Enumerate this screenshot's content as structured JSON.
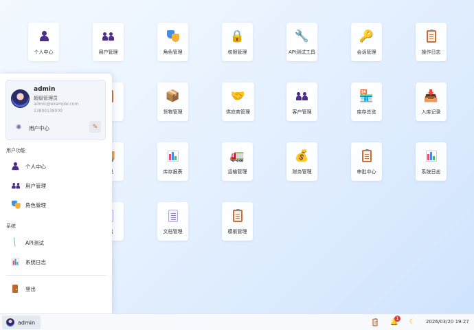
{
  "desktop": {
    "apps": [
      {
        "label": "个人中心",
        "icon": "person-icon"
      },
      {
        "label": "用户管理",
        "icon": "users-icon"
      },
      {
        "label": "角色管理",
        "icon": "masks-icon"
      },
      {
        "label": "权限管理",
        "icon": "lock-icon"
      },
      {
        "label": "API测试工具",
        "icon": "wrench-icon"
      },
      {
        "label": "会话管理",
        "icon": "key-icon"
      },
      {
        "label": "操作日志",
        "icon": "clipboard-icon"
      },
      {
        "label": "理",
        "icon": "clipboard-icon"
      },
      {
        "label": "货物管理",
        "icon": "package-icon"
      },
      {
        "label": "供应商管理",
        "icon": "handshake-icon"
      },
      {
        "label": "客户管理",
        "icon": "users-icon"
      },
      {
        "label": "库存总览",
        "icon": "store-icon"
      },
      {
        "label": "入库记录",
        "icon": "inbox-icon"
      },
      {
        "label": "管理",
        "icon": "truck-icon"
      },
      {
        "label": "库存报表",
        "icon": "bar-chart-icon"
      },
      {
        "label": "运输管理",
        "icon": "truck-icon"
      },
      {
        "label": "财务管理",
        "icon": "money-bag-icon"
      },
      {
        "label": "审批中心",
        "icon": "clipboard-icon"
      },
      {
        "label": "系统日志",
        "icon": "bar-chart-icon"
      },
      {
        "label": "导出",
        "icon": "export-icon"
      },
      {
        "label": "文档管理",
        "icon": "document-icon"
      },
      {
        "label": "模板管理",
        "icon": "clipboard-icon"
      }
    ]
  },
  "start_menu": {
    "profile": {
      "name": "admin",
      "role": "超级管理员",
      "email": "admin@example.com",
      "phone": "13800138000",
      "center_label": "用户中心"
    },
    "section_user": "用户功能",
    "user_items": [
      {
        "label": "个人中心",
        "icon": "person-icon"
      },
      {
        "label": "用户管理",
        "icon": "users-icon"
      },
      {
        "label": "角色管理",
        "icon": "masks-icon"
      }
    ],
    "section_system": "系统",
    "system_items": [
      {
        "label": "API测试",
        "icon": "wrench-icon"
      },
      {
        "label": "系统日志",
        "icon": "bar-chart-icon"
      }
    ],
    "logout_label": "登出"
  },
  "taskbar": {
    "user_name": "admin",
    "notification_count": "1",
    "datetime": "2026/03/20 19:27"
  }
}
